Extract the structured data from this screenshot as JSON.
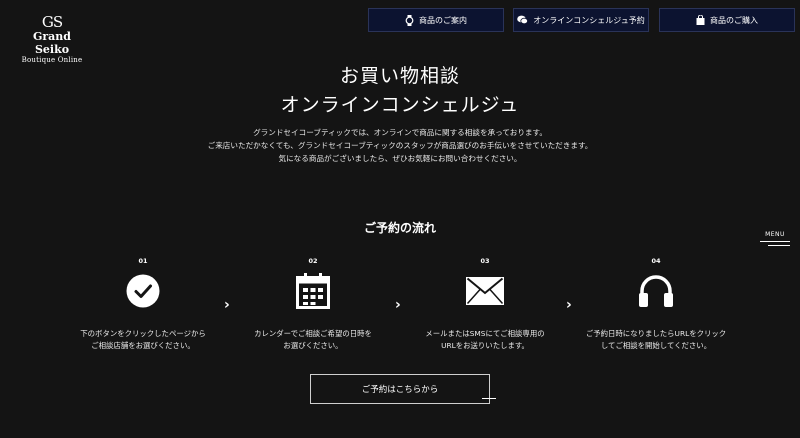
{
  "logo": {
    "mark": "GS",
    "name": "Grand Seiko",
    "sub": "Boutique Online"
  },
  "nav": [
    {
      "label": "商品のご案内",
      "icon": "watch-icon"
    },
    {
      "label": "オンラインコンシェルジュ予約",
      "icon": "chat-bubble-icon"
    },
    {
      "label": "商品のご購入",
      "icon": "shopping-bag-icon"
    }
  ],
  "hero": {
    "title_line1": "お買い物相談",
    "title_line2": "オンラインコンシェルジュ",
    "intro_lines": [
      "グランドセイコーブティックでは、オンラインで商品に関する相談を承っております。",
      "ご来店いただかなくても、グランドセイコーブティックのスタッフが商品選びのお手伝いをさせていただきます。",
      "気になる商品がございましたら、ぜひお気軽にお問い合わせください。"
    ]
  },
  "flow": {
    "title": "ご予約の流れ",
    "steps": [
      {
        "num": "01",
        "icon": "check-circle-icon",
        "line1": "下のボタンをクリックしたページから",
        "line2": "ご相談店舗をお選びください。"
      },
      {
        "num": "02",
        "icon": "calendar-icon",
        "line1": "カレンダーでご相談ご希望の日時を",
        "line2": "お選びください。"
      },
      {
        "num": "03",
        "icon": "envelope-icon",
        "line1": "メールまたはSMSにてご相談専用の",
        "line2": "URLをお送りいたします。"
      },
      {
        "num": "04",
        "icon": "headphones-icon",
        "line1": "ご予約日時になりましたらURLをクリック",
        "line2": "してご相談を開始してください。"
      }
    ],
    "arrow": "›"
  },
  "cta_label": "ご予約はこちらから",
  "menu_label": "MENU",
  "colors": {
    "background": "#141414",
    "nav_bg": "#0c1330",
    "text": "#ffffff"
  }
}
